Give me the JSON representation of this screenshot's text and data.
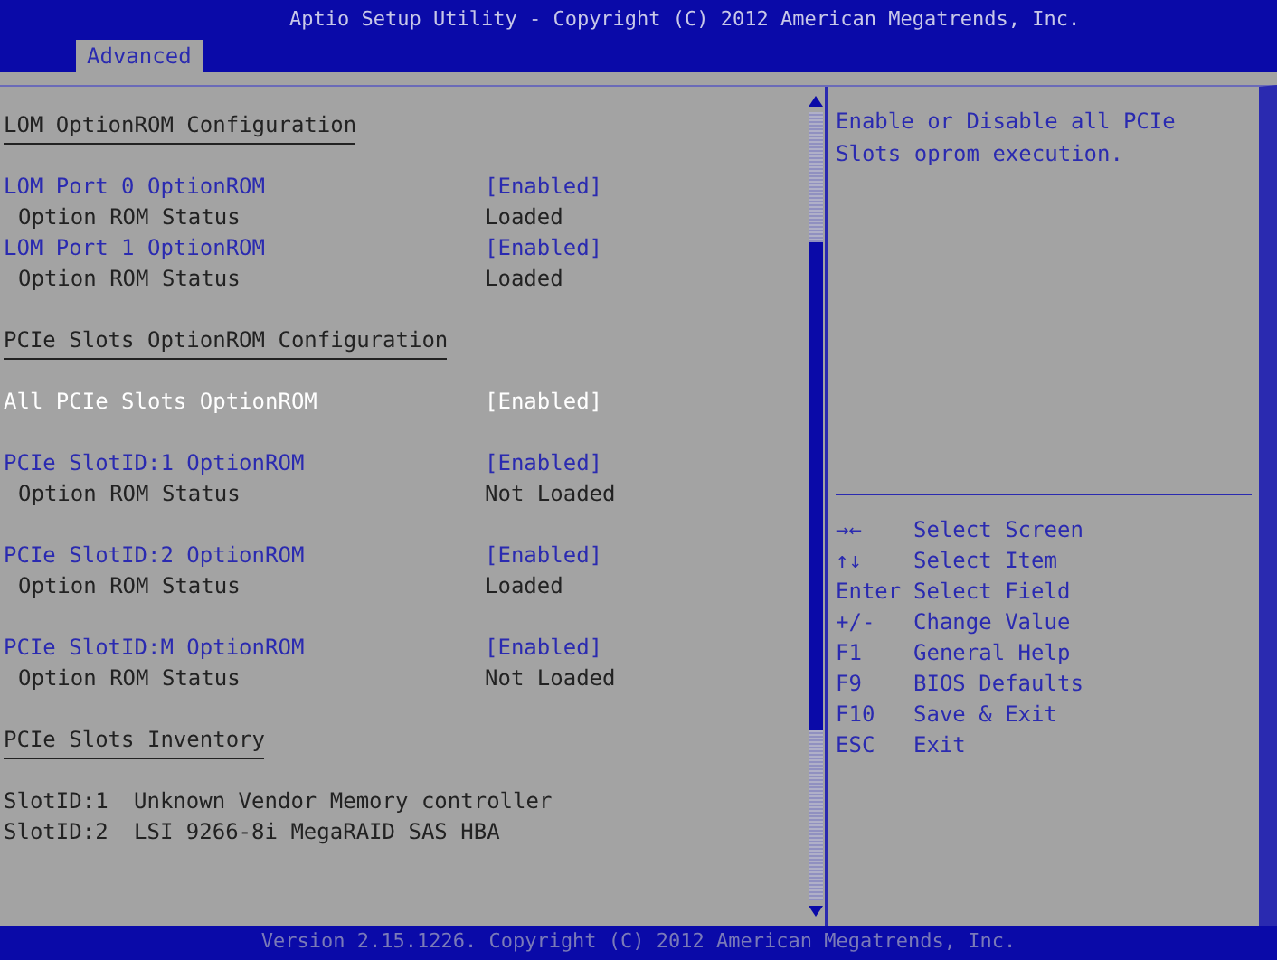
{
  "window": {
    "title": "Aptio Setup Utility - Copyright (C) 2012 American Megatrends, Inc."
  },
  "tabs": [
    {
      "label": "Advanced",
      "selected": true
    }
  ],
  "sections": [
    {
      "title": "LOM OptionROM Configuration",
      "groups": [
        [
          {
            "kind": "setting",
            "label": "LOM Port 0 OptionROM",
            "value": "[Enabled]",
            "selected": false
          },
          {
            "kind": "status",
            "label": "Option ROM Status",
            "value": "Loaded"
          },
          {
            "kind": "setting",
            "label": "LOM Port 1 OptionROM",
            "value": "[Enabled]",
            "selected": false
          },
          {
            "kind": "status",
            "label": "Option ROM Status",
            "value": "Loaded"
          }
        ]
      ]
    },
    {
      "title": "PCIe Slots OptionROM Configuration",
      "groups": [
        [
          {
            "kind": "setting",
            "label": "All PCIe Slots OptionROM",
            "value": "[Enabled]",
            "selected": true
          }
        ],
        [
          {
            "kind": "setting",
            "label": "PCIe SlotID:1 OptionROM",
            "value": "[Enabled]",
            "selected": false
          },
          {
            "kind": "status",
            "label": "Option ROM Status",
            "value": "Not Loaded"
          }
        ],
        [
          {
            "kind": "setting",
            "label": "PCIe SlotID:2 OptionROM",
            "value": "[Enabled]",
            "selected": false
          },
          {
            "kind": "status",
            "label": "Option ROM Status",
            "value": "Loaded"
          }
        ],
        [
          {
            "kind": "setting",
            "label": "PCIe SlotID:M OptionROM",
            "value": "[Enabled]",
            "selected": false
          },
          {
            "kind": "status",
            "label": "Option ROM Status",
            "value": "Not Loaded"
          }
        ]
      ]
    },
    {
      "title": "PCIe Slots Inventory",
      "groups": [
        [
          {
            "kind": "inventory",
            "label": "SlotID:1",
            "value": "Unknown Vendor Memory controller"
          },
          {
            "kind": "inventory",
            "label": "SlotID:2",
            "value": "LSI 9266-8i MegaRAID SAS HBA"
          }
        ]
      ]
    }
  ],
  "help": {
    "text": "Enable or Disable all PCIe Slots oprom execution."
  },
  "keys": [
    {
      "key": "→←",
      "action": "Select Screen"
    },
    {
      "key": "↑↓",
      "action": "Select Item"
    },
    {
      "key": "Enter",
      "action": "Select Field"
    },
    {
      "key": "+/-",
      "action": "Change Value"
    },
    {
      "key": "F1",
      "action": "General Help"
    },
    {
      "key": "F9",
      "action": "BIOS Defaults"
    },
    {
      "key": "F10",
      "action": "Save & Exit"
    },
    {
      "key": "ESC",
      "action": "Exit"
    }
  ],
  "status_bar": {
    "text": "Version 2.15.1226. Copyright (C) 2012 American Megatrends, Inc."
  }
}
